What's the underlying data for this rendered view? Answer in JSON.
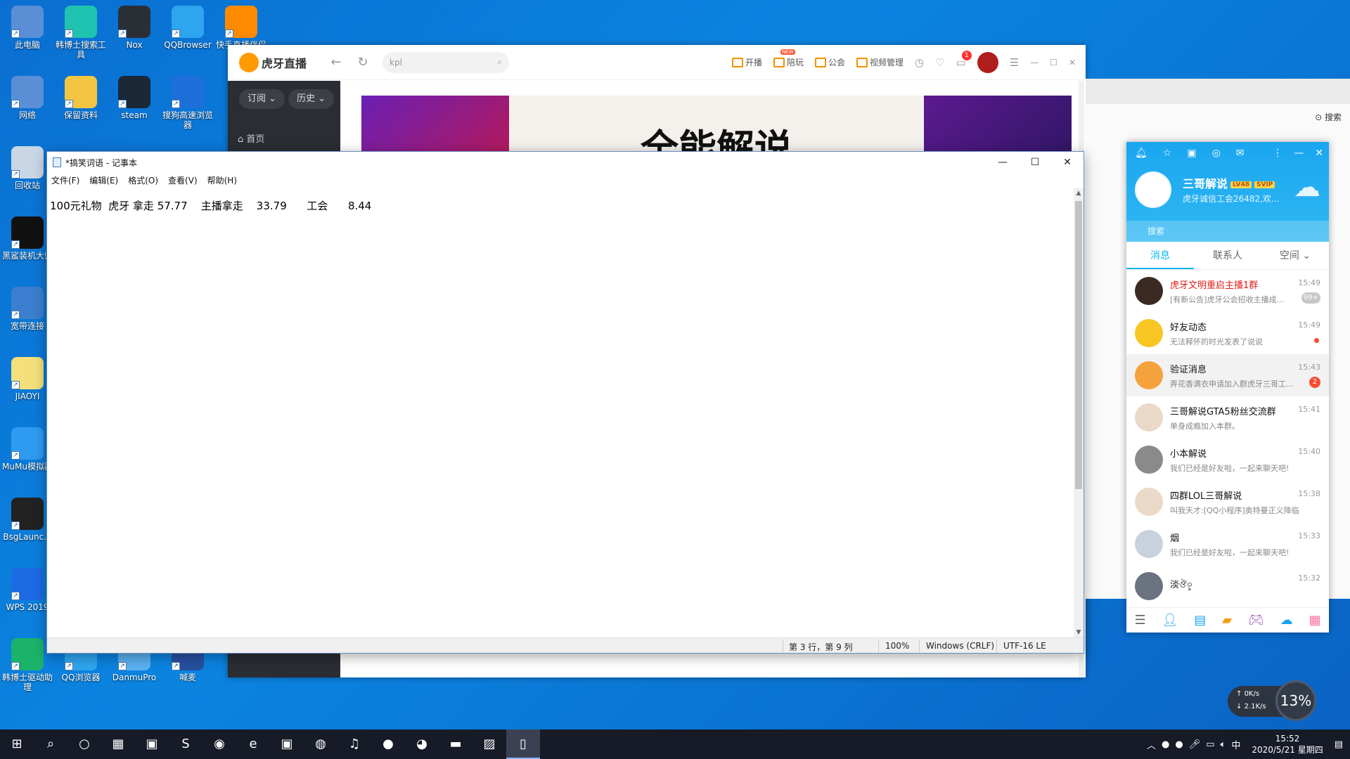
{
  "desktop_icons": [
    {
      "label": "此电脑",
      "icon": "computer-icon",
      "color": "#5a8fd6"
    },
    {
      "label": "韩博士搜索工具",
      "icon": "search-tool-icon",
      "color": "#20c3b0"
    },
    {
      "label": "Nox",
      "icon": "nox-icon",
      "color": "#2a2f36"
    },
    {
      "label": "QQBrowser",
      "icon": "qqbrowser-icon",
      "color": "#2ea5ef"
    },
    {
      "label": "快手直播伴侣",
      "icon": "kuaishou-icon",
      "color": "#ff8a00"
    },
    {
      "label": "网络",
      "icon": "network-icon",
      "color": "#5a8fd6"
    },
    {
      "label": "保留资料",
      "icon": "folder-icon",
      "color": "#f4c542"
    },
    {
      "label": "steam",
      "icon": "steam-icon",
      "color": "#1b2838"
    },
    {
      "label": "搜狗高速浏览器",
      "icon": "sogou-browser-icon",
      "color": "#1e6fd9"
    },
    {
      "label": "回收站",
      "icon": "recycle-bin-icon",
      "color": "#c9d6e6"
    },
    {
      "label": "黑鲨装机大师",
      "icon": "blackshark-icon",
      "color": "#111"
    },
    {
      "label": "宽带连接",
      "icon": "broadband-icon",
      "color": "#3c7fd0"
    },
    {
      "label": "JIAOYI",
      "icon": "folder-icon",
      "color": "#f4e07a"
    },
    {
      "label": "MuMu模拟器",
      "icon": "mumu-icon",
      "color": "#2f9bf0"
    },
    {
      "label": "BsgLaunc...",
      "icon": "bsg-launcher-icon",
      "color": "#222"
    },
    {
      "label": "WPS 2019",
      "icon": "wps-icon",
      "color": "#1d6ae5"
    },
    {
      "label": "韩博士驱动助理",
      "icon": "driver-assistant-icon",
      "color": "#1bb36a"
    },
    {
      "label": "QQ浏览器",
      "icon": "qqbrowser-icon",
      "color": "#2ea5ef"
    },
    {
      "label": "DanmuPro",
      "icon": "danmupro-icon",
      "color": "#5ab0f0"
    },
    {
      "label": "喊麦",
      "icon": "hanmai-icon",
      "color": "#2850a0"
    }
  ],
  "huya": {
    "logo_text": "虎牙直播",
    "search_placeholder": "kpl",
    "tools": [
      "开播",
      "陪玩",
      "公会",
      "视频管理"
    ],
    "new_badge": "NEW",
    "notif_count": "1",
    "side_subscribe": "订阅",
    "side_history": "历史",
    "side_home": "首页",
    "banner_text": "全能解说"
  },
  "remnant": {
    "search_label": "搜索"
  },
  "notepad": {
    "title": "*搞笑词语 - 记事本",
    "menu": [
      "文件(F)",
      "编辑(E)",
      "格式(O)",
      "查看(V)",
      "帮助(H)"
    ],
    "content": "100元礼物  虎牙 拿走 57.77    主播拿走    33.79      工会      8.44",
    "status": {
      "position": "第 3 行，第 9 列",
      "zoom": "100%",
      "eol": "Windows (CRLF)",
      "encoding": "UTF-16 LE"
    }
  },
  "qq": {
    "name": "三哥解说",
    "badge_lv": "LV48",
    "badge_svip": "SVIP",
    "signature": "虎牙诚信工会26482,欢...",
    "search_placeholder": "搜索",
    "tabs": [
      "消息",
      "联系人",
      "空间"
    ],
    "items": [
      {
        "name": "虎牙文明重启主播1群",
        "preview": "[有新公告]虎牙公会招收主播成...",
        "time": "15:49",
        "badge": "99+",
        "badge_style": "gray",
        "red": true,
        "avatar_color": "#3a2a22"
      },
      {
        "name": "好友动态",
        "preview": "无法释怀的时光发表了说说",
        "time": "15:49",
        "dot": true,
        "avatar_color": "#f7c623"
      },
      {
        "name": "验证消息",
        "preview": "弄花香满衣申请加入群虎牙三哥工...",
        "time": "15:43",
        "badge": "2",
        "avatar_color": "#f4a23b",
        "highlight": true
      },
      {
        "name": "三哥解说GTA5粉丝交流群",
        "preview": "单身成瘾加入本群。",
        "time": "15:41",
        "avatar_color": "#e9d9c6"
      },
      {
        "name": "小本解说",
        "preview": "我们已经是好友啦，一起来聊天吧!",
        "time": "15:40",
        "avatar_color": "#8a8a8a"
      },
      {
        "name": "四群LOL三哥解说",
        "preview": "叫我天才:[QQ小程序]奥特曼正义降临",
        "time": "15:38",
        "avatar_color": "#e9d9c6"
      },
      {
        "name": "烟",
        "preview": "我们已经是好友啦，一起来聊天吧!",
        "time": "15:33",
        "avatar_color": "#c9d2dc"
      },
      {
        "name": "淡ঔ০ৢ",
        "preview": "",
        "time": "15:32",
        "avatar_color": "#6b7280"
      }
    ]
  },
  "speed": {
    "up": "0K/s",
    "down": "2.1K/s",
    "cpu": "13%"
  },
  "taskbar": {
    "icons": [
      "windows-start-icon",
      "search-icon",
      "cortana-icon",
      "task-view-icon",
      "app-icon",
      "sogou-icon",
      "qqbrowser-icon",
      "edge-icon",
      "app-icon",
      "obs-icon",
      "netease-music-icon",
      "huya-icon",
      "qq-icon",
      "file-explorer-icon",
      "photos-icon",
      "notepad-icon"
    ],
    "time": "15:52",
    "date": "2020/5/21 星期四",
    "ime": "中"
  }
}
